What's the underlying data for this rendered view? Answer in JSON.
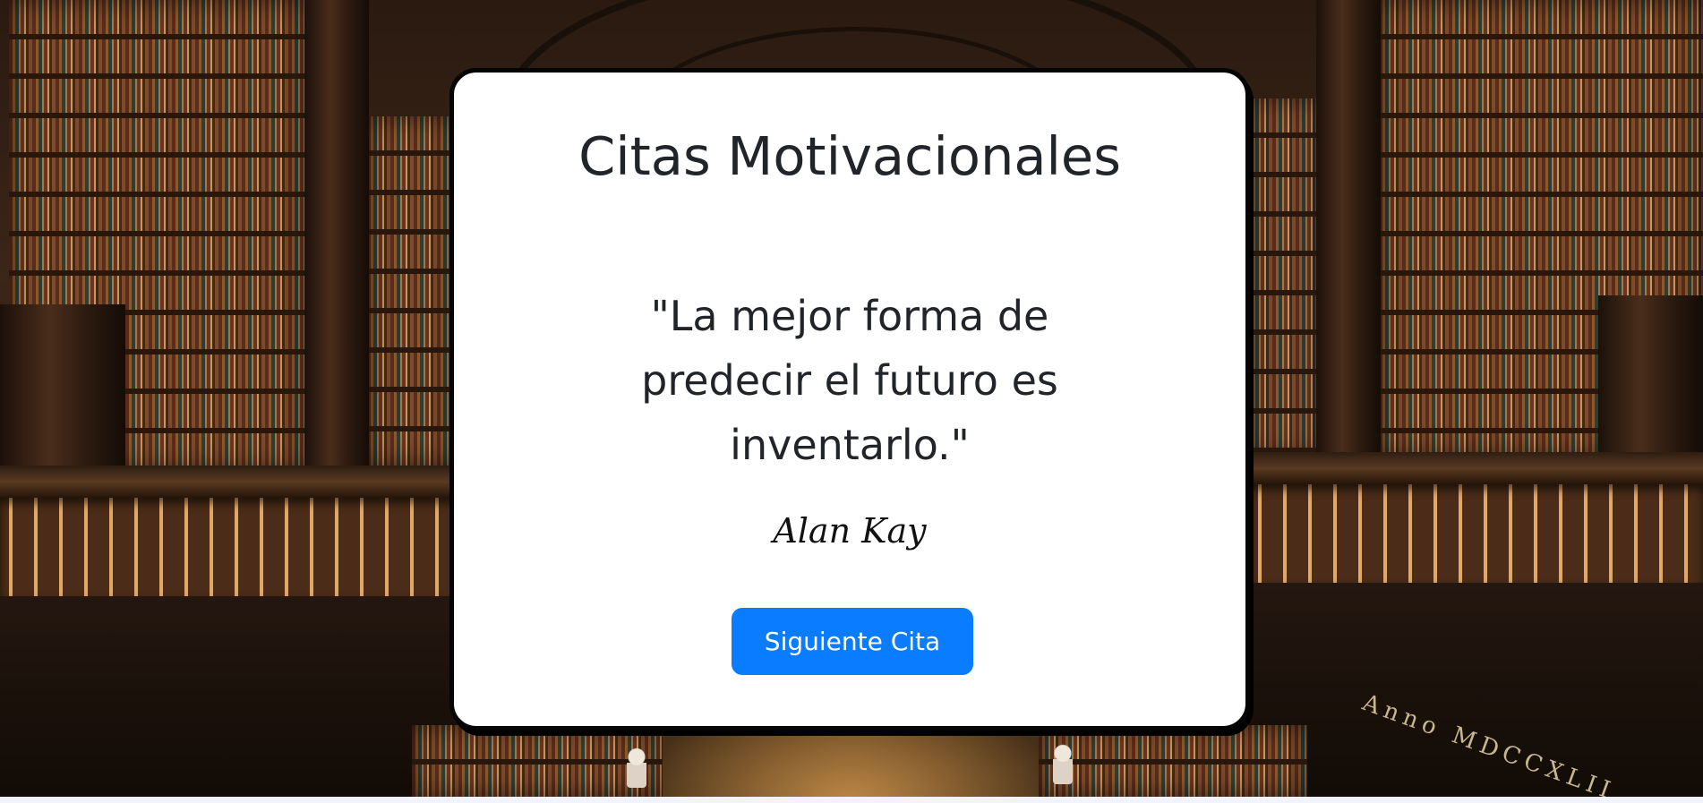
{
  "card": {
    "title": "Citas Motivacionales",
    "quote": "\"La mejor forma de predecir el futuro es inventarlo.\"",
    "author": "Alan Kay",
    "next_button_label": "Siguiente Cita"
  },
  "background": {
    "inscription": "Anno MDCCXLII"
  },
  "colors": {
    "accent": "#0a7cff",
    "card_background": "#ffffff",
    "card_border": "#050505",
    "text": "#212529"
  }
}
